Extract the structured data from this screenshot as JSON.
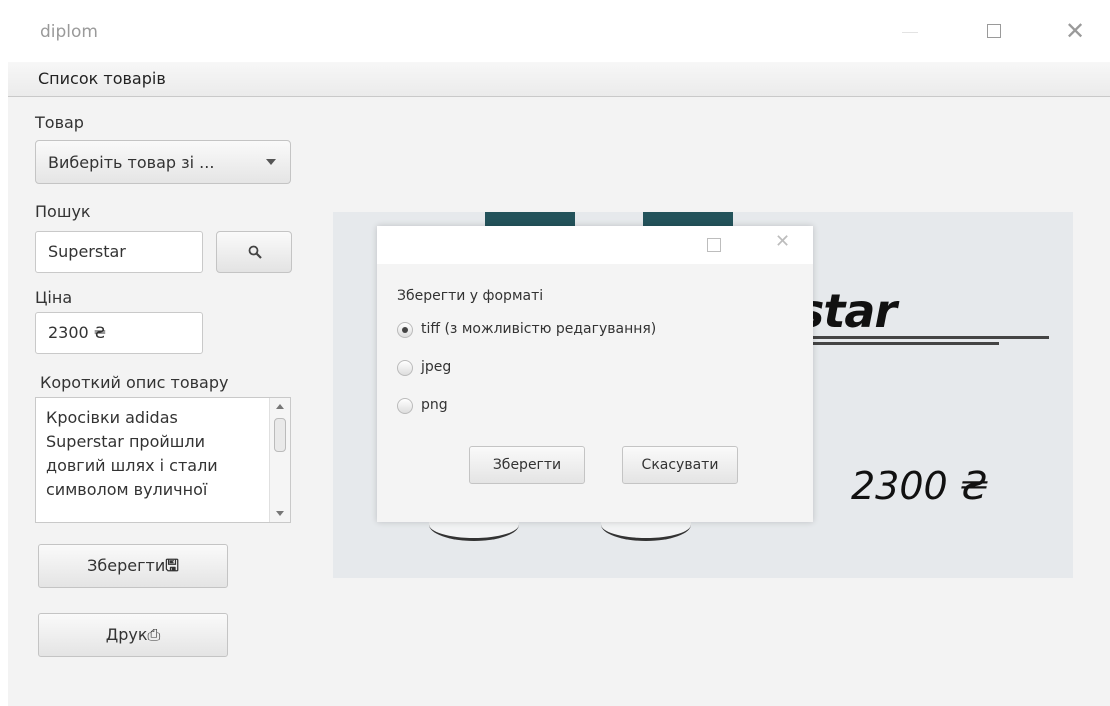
{
  "window": {
    "title": "diplom"
  },
  "menu": {
    "items": [
      "Список товарів"
    ]
  },
  "form": {
    "product_label": "Товар",
    "product_select": "Виберіть товар зі ...",
    "search_label": "Пошук",
    "search_value": "Superstar",
    "price_label": "Ціна",
    "price_value": "2300 ₴",
    "description_label": "Короткий опис товару",
    "description_text": "Кросівки adidas\nSuperstar пройшли\nдовгий шлях і стали\nсимволом вуличної",
    "save_button": "Зберегти",
    "print_button": "Друк"
  },
  "preview": {
    "brand": "star",
    "price": "2300 ₴"
  },
  "dialog": {
    "prompt": "Зберегти у форматі",
    "options": [
      {
        "label": "tiff (з можливістю редагування)",
        "checked": true
      },
      {
        "label": "jpeg",
        "checked": false
      },
      {
        "label": "png",
        "checked": false
      }
    ],
    "save_button": "Зберегти",
    "cancel_button": "Скасувати"
  }
}
